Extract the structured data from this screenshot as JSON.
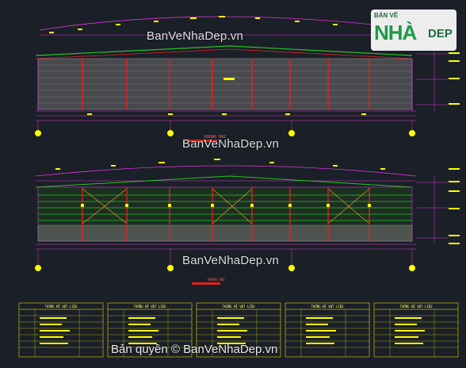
{
  "watermarks": {
    "top": "BanVeNhaDep.vn",
    "middle": "BanVeNhaDep.vn",
    "bottom": "BanVeNhaDep.vn"
  },
  "copyright": "Bản quyền © BanVeNhaDep.vn",
  "logo": {
    "line1": "BẢN VẼ",
    "line2": "NHÀ",
    "line3": "DEP"
  },
  "drawing": {
    "elevation_top_label": "KHUNG DN1",
    "elevation_bottom_label": "KHUNG DN2",
    "tables": [
      {
        "title": "THỐNG KÊ VẬT LIỆU"
      },
      {
        "title": "THỐNG KÊ VẬT LIỆU"
      },
      {
        "title": "THỐNG KÊ VẬT LIỆU"
      },
      {
        "title": "THỐNG KÊ VẬT LIỆU"
      },
      {
        "title": "THỐNG KÊ VẬT LIỆU"
      }
    ]
  },
  "colors": {
    "background": "#1b1f27",
    "frame_magenta": "#d63bd6",
    "dim_yellow": "#ffff00",
    "column_red": "#e02020",
    "green_line": "#27c427",
    "cyan_line": "#3fd3d3",
    "grid_gray": "#8a8a8a"
  }
}
